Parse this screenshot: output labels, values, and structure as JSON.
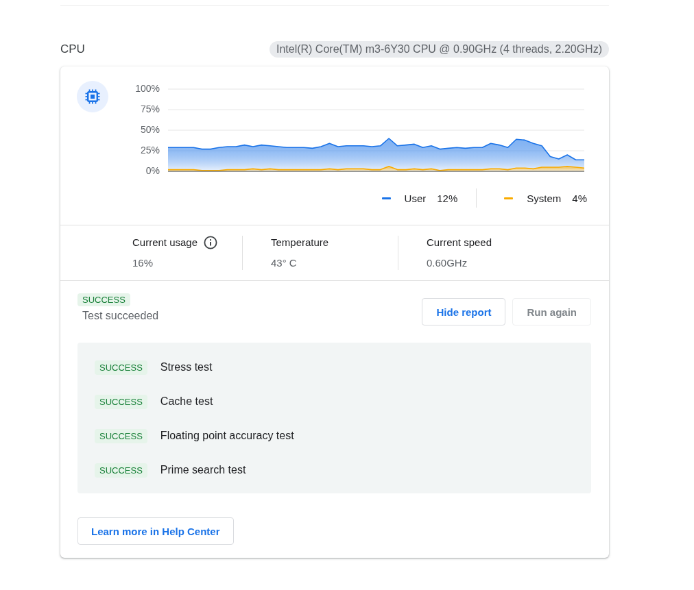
{
  "section": {
    "title": "CPU",
    "chip": "Intel(R) Core(TM) m3-6Y30 CPU @ 0.90GHz (4 threads, 2.20GHz)"
  },
  "chart": {
    "chart_data": {
      "type": "area",
      "grid": true,
      "ylim": [
        0,
        100
      ],
      "yticks": [
        {
          "value": 0,
          "label": "0%"
        },
        {
          "value": 25,
          "label": "25%"
        },
        {
          "value": 50,
          "label": "50%"
        },
        {
          "value": 75,
          "label": "75%"
        },
        {
          "value": 100,
          "label": "100%"
        }
      ],
      "series": [
        {
          "name": "User",
          "color": "#1a73e8",
          "values": [
            29,
            29,
            29,
            29,
            27,
            27,
            29,
            30,
            30,
            32,
            30,
            32,
            31,
            30,
            29,
            29,
            29,
            28,
            30,
            34,
            30,
            31,
            31,
            31,
            30,
            31,
            40,
            31,
            32,
            33,
            29,
            31,
            27,
            28,
            29,
            28,
            29,
            29,
            34,
            32,
            29,
            39,
            38,
            34,
            31,
            18,
            15,
            20,
            14,
            14
          ]
        },
        {
          "name": "System",
          "color": "#f9ab00",
          "values": [
            2,
            2,
            2,
            2,
            1,
            1,
            1,
            2,
            2,
            2,
            3,
            2,
            3,
            2,
            2,
            2,
            2,
            2,
            2,
            3,
            2,
            3,
            3,
            3,
            2,
            2,
            6,
            2,
            2,
            3,
            2,
            3,
            1,
            2,
            2,
            2,
            2,
            2,
            3,
            3,
            2,
            4,
            4,
            3,
            5,
            5,
            5,
            6,
            5,
            4
          ]
        }
      ]
    },
    "readings": [
      "12%",
      "4%"
    ]
  },
  "stats": [
    {
      "label": "Current usage",
      "value": "16%",
      "info": true
    },
    {
      "label": "Temperature",
      "value": "43° C",
      "info": false
    },
    {
      "label": "Current speed",
      "value": "0.60GHz",
      "info": false
    }
  ],
  "result": {
    "badge": {
      "label": "SUCCESS",
      "kind": "success"
    },
    "message": "Test succeeded"
  },
  "actions": [
    {
      "label": "Hide report",
      "disabled": false
    },
    {
      "label": "Run again",
      "disabled": true
    }
  ],
  "report": [
    {
      "badge": "SUCCESS",
      "kind": "success",
      "name": "Stress test"
    },
    {
      "badge": "SUCCESS",
      "kind": "success",
      "name": "Cache test"
    },
    {
      "badge": "SUCCESS",
      "kind": "success",
      "name": "Floating point accuracy test"
    },
    {
      "badge": "SUCCESS",
      "kind": "success",
      "name": "Prime search test"
    }
  ],
  "help_button": "Learn more in Help Center"
}
